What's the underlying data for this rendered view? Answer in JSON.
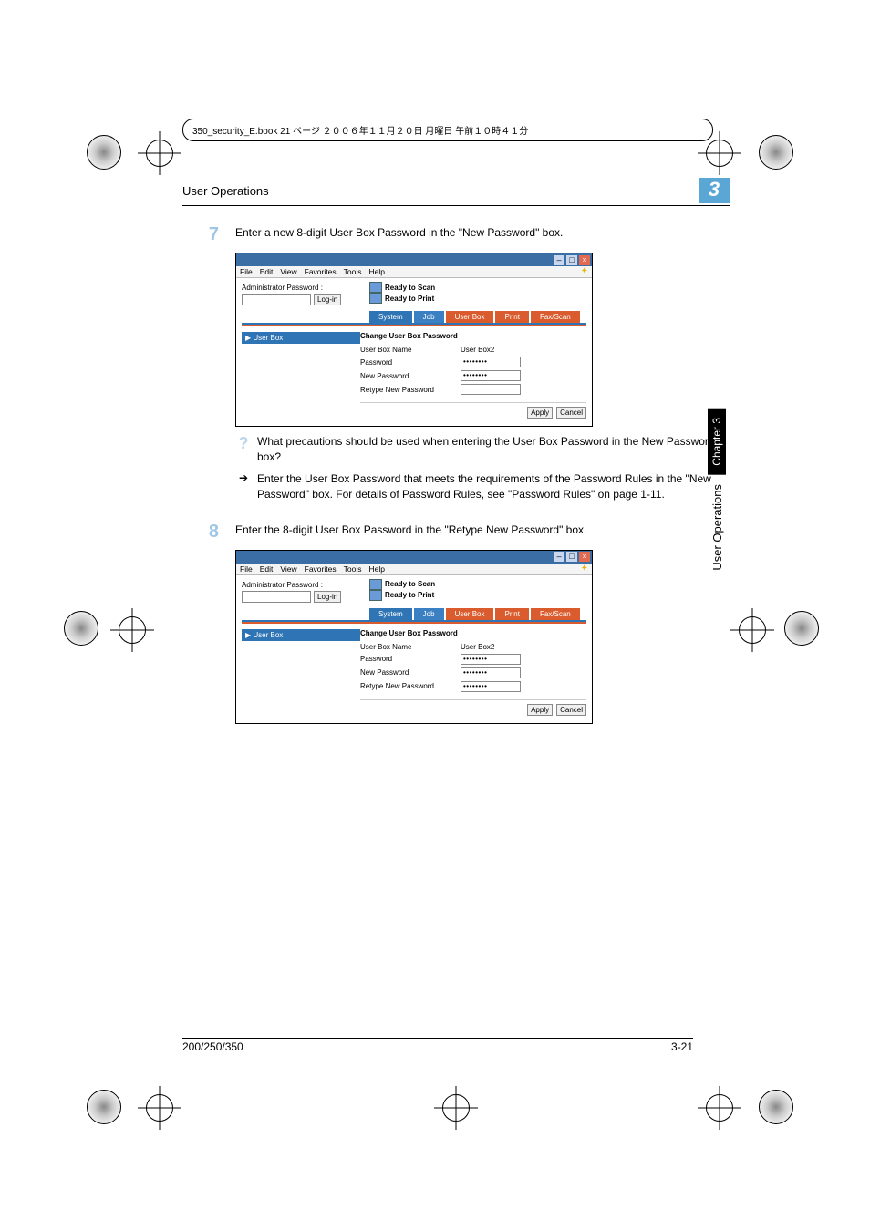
{
  "stamp": "350_security_E.book 21 ページ ２００６年１１月２０日 月曜日 午前１０時４１分",
  "header": {
    "title": "User Operations",
    "chapter_num": "3"
  },
  "side_tab": {
    "chapter": "Chapter 3",
    "section": "User Operations"
  },
  "footer": {
    "left": "200/250/350",
    "right": "3-21"
  },
  "steps": {
    "s7": {
      "num": "7",
      "text": "Enter a new 8-digit User Box Password in the \"New Password\" box."
    },
    "s8": {
      "num": "8",
      "text": "Enter the 8-digit User Box Password in the \"Retype New Password\" box."
    }
  },
  "qa": {
    "question": "What precautions should be used when entering the User Box Password in the New Password box?",
    "answer": "Enter the User Box Password that meets the requirements of the Password Rules in the \"New Password\" box. For details of Password Rules, see \"Password Rules\" on page 1-11."
  },
  "shot": {
    "menubar": [
      "File",
      "Edit",
      "View",
      "Favorites",
      "Tools",
      "Help"
    ],
    "status1": "Ready to Scan",
    "status2": "Ready to Print",
    "admin_label": "Administrator Password :",
    "login_btn": "Log-in",
    "tabs": {
      "system": "System",
      "job": "Job",
      "userbox": "User Box",
      "print": "Print",
      "faxscan": "Fax/Scan"
    },
    "side_item": "▶ User Box",
    "pane_title": "Change User Box Password",
    "rows": {
      "name_l": "User Box Name",
      "name_v": "User Box2",
      "pw_l": "Password",
      "npw_l": "New Password",
      "rpw_l": "Retype New Password"
    },
    "masked": "••••••••",
    "apply": "Apply",
    "cancel": "Cancel"
  }
}
